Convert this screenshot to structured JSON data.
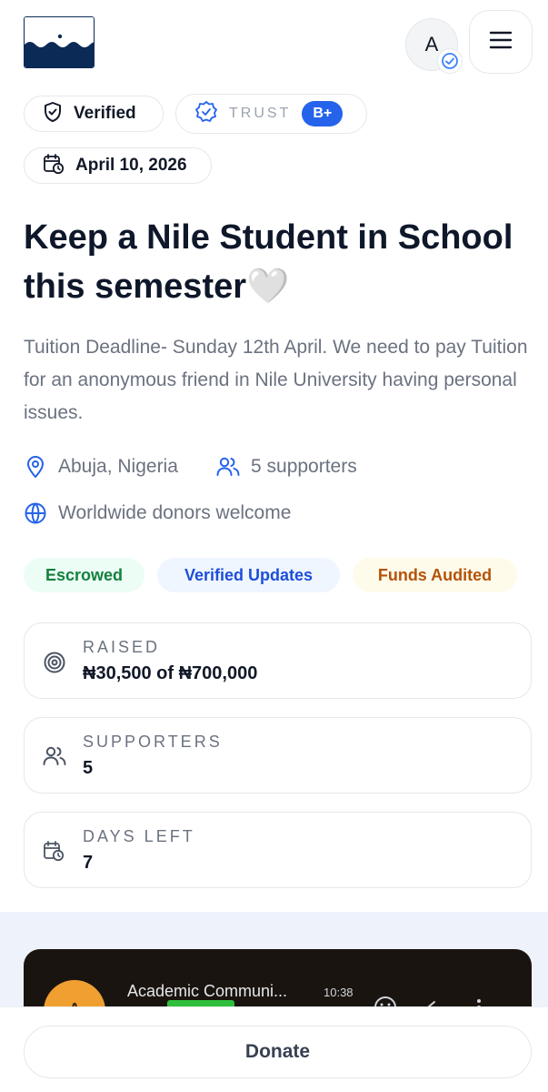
{
  "header": {
    "avatar_initial": "A"
  },
  "chips": {
    "verified": "Verified",
    "trust_label": "TRUST",
    "trust_grade": "B+",
    "date": "April 10, 2026"
  },
  "campaign": {
    "title": "Keep a Nile Student in School this semester🤍",
    "description": "Tuition Deadline- Sunday 12th April. We need to pay Tuition for an anonymous friend in Nile University having personal issues.",
    "location": "Abuja, Nigeria",
    "supporters_text": "5 supporters",
    "reach": "Worldwide donors welcome"
  },
  "badges": {
    "escrowed": "Escrowed",
    "verified_updates": "Verified Updates",
    "funds_audited": "Funds Audited"
  },
  "stats": {
    "raised_label": "RAISED",
    "raised_value": "₦30,500 of ₦700,000",
    "supporters_label": "SUPPORTERS",
    "supporters_value": "5",
    "days_label": "DAYS LEFT",
    "days_value": "7"
  },
  "media": {
    "avatar_initial": "A",
    "chat_name": "Academic Communi...",
    "chat_time": "10:38"
  },
  "footer": {
    "donate_label": "Donate"
  },
  "colors": {
    "accent": "#2563eb",
    "escrow_green": "#15803d",
    "audited_amber": "#b45309",
    "logo_navy": "#0b2a55"
  },
  "icons": [
    "shield-check-icon",
    "badge-check-icon",
    "calendar-clock-icon",
    "map-pin-icon",
    "users-icon",
    "globe-icon",
    "target-icon",
    "menu-icon",
    "verified-check-icon"
  ]
}
